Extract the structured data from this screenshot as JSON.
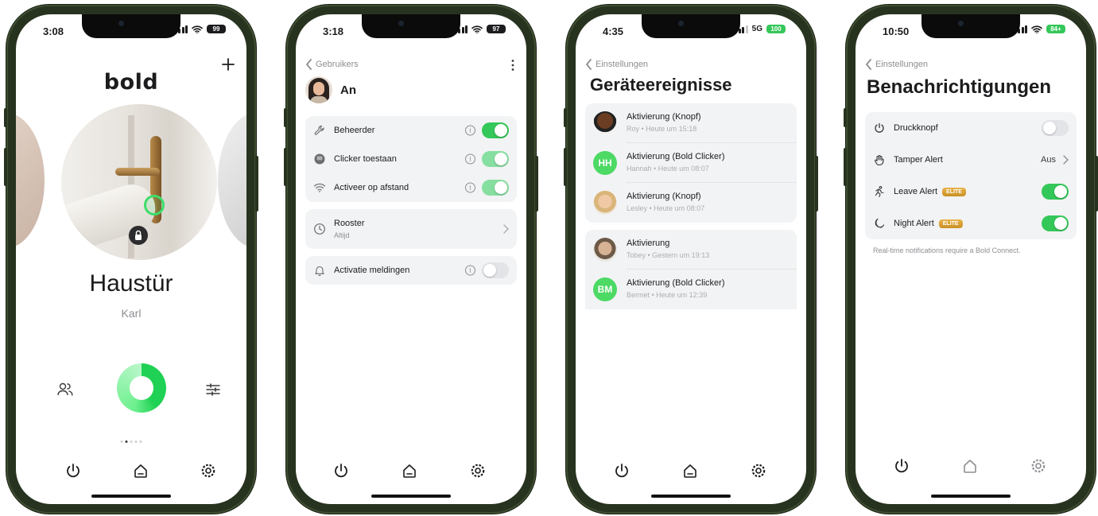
{
  "status_bars": [
    {
      "time": "3:08",
      "battery": "99",
      "network": ""
    },
    {
      "time": "3:18",
      "battery": "97",
      "network": ""
    },
    {
      "time": "4:35",
      "battery": "100",
      "network": "5G"
    },
    {
      "time": "10:50",
      "battery": "84+",
      "network": ""
    }
  ],
  "colors": {
    "accent": "#34c759",
    "group_bg": "#f2f3f4",
    "muted": "#8e8e93",
    "elite_badge": "#d9a23a"
  },
  "screen1": {
    "logo": "bold",
    "add_icon": "plus-icon",
    "lock_name": "Haustür",
    "lock_owner": "Karl",
    "icons": [
      "users-icon",
      "lock-button",
      "sliders-icon"
    ]
  },
  "screen2": {
    "back_label": "Gebruikers",
    "user_name": "An",
    "permissions": [
      {
        "label": "Beheerder",
        "icon": "wrench-icon",
        "enabled": true
      },
      {
        "label": "Clicker toestaan",
        "icon": "clicker-icon",
        "enabled": true
      },
      {
        "label": "Activeer op afstand",
        "icon": "wifi-icon",
        "enabled": true
      }
    ],
    "schedule": {
      "label": "Rooster",
      "value": "Altijd"
    },
    "notifications": {
      "label": "Activatie meldingen",
      "enabled": false
    }
  },
  "screen3": {
    "back_label": "Einstellungen",
    "title": "Geräteereignisse",
    "groups": [
      [
        {
          "title": "Aktivierung (Knopf)",
          "subtitle": "Roy • Heute um 15:18",
          "avatar": "photo"
        },
        {
          "title": "Aktivierung (Bold Clicker)",
          "subtitle": "Hannah • Heute um 08:07",
          "avatar": "HH"
        },
        {
          "title": "Aktivierung (Knopf)",
          "subtitle": "Lesley • Heute um 08:07",
          "avatar": "photo"
        }
      ],
      [
        {
          "title": "Aktivierung",
          "subtitle": "Tobey • Gestern um 19:13",
          "avatar": "photo"
        },
        {
          "title": "Aktivierung (Bold Clicker)",
          "subtitle": "Bermet • Heute um 12:39",
          "avatar": "BM"
        }
      ]
    ]
  },
  "screen4": {
    "back_label": "Einstellungen",
    "title": "Benachrichtigungen",
    "rows": [
      {
        "label": "Druckknopf",
        "icon": "power-icon",
        "type": "toggle",
        "enabled": false
      },
      {
        "label": "Tamper Alert",
        "icon": "hand-icon",
        "type": "value",
        "value": "Aus"
      },
      {
        "label": "Leave Alert",
        "icon": "running-icon",
        "type": "toggle",
        "enabled": true,
        "badge": "ELITE"
      },
      {
        "label": "Night Alert",
        "icon": "moon-icon",
        "type": "toggle",
        "enabled": true,
        "badge": "ELITE"
      }
    ],
    "footnote": "Real-time notifications require a Bold Connect."
  }
}
